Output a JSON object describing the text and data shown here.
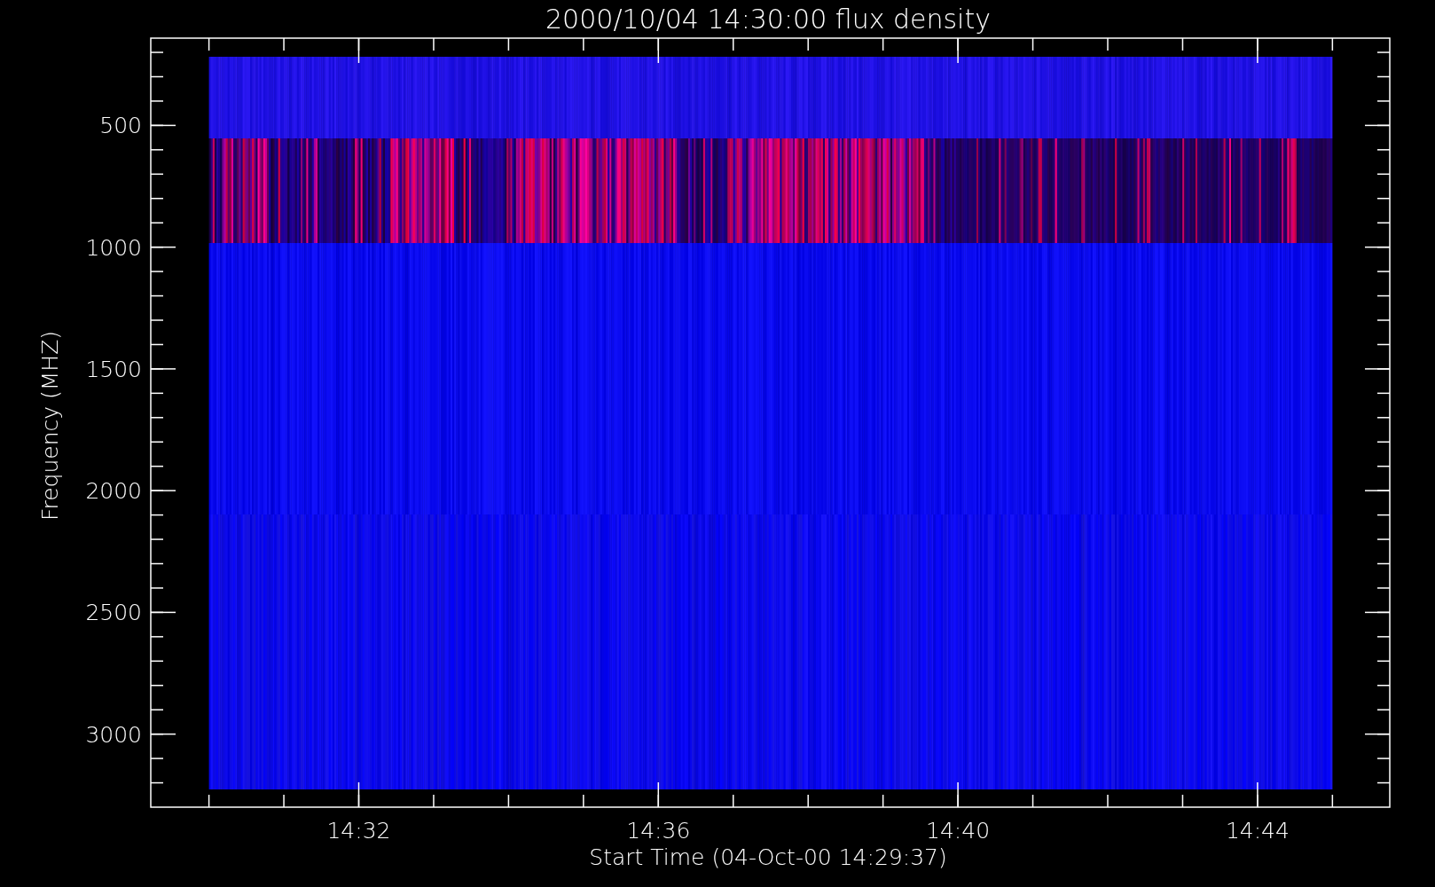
{
  "plot": {
    "title": "2000/10/04 14:30:00 flux density",
    "xlabel": "Start Time (04-Oct-00 14:29:37)",
    "ylabel": "Frequency (MHZ)",
    "xtick_labels": [
      "14:32",
      "14:36",
      "14:40",
      "14:44"
    ],
    "ytick_labels": [
      "500",
      "1000",
      "1500",
      "2000",
      "2500",
      "3000"
    ]
  }
}
